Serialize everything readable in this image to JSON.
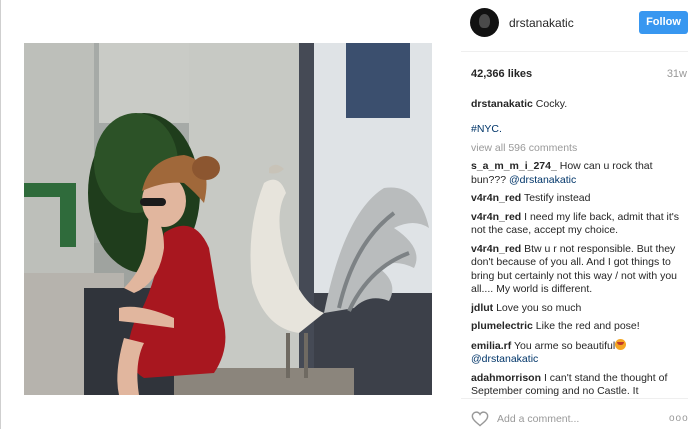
{
  "post": {
    "username": "drstanakatic",
    "follow_label": "Follow",
    "likes": "42,366 likes",
    "age": "31w",
    "caption_user": "drstanakatic",
    "caption_text": "Cocky.",
    "hashtag": "#NYC.",
    "view_all": "view all 596 comments",
    "add_comment_placeholder": "Add a comment...",
    "more": "ooo"
  },
  "comments": [
    {
      "user": "s_a_m_m_i_274_",
      "text": "How can u rock that bun???",
      "mention": "@drstanakatic"
    },
    {
      "user": "v4r4n_red",
      "text": "Testify instead"
    },
    {
      "user": "v4r4n_red",
      "text": "I need my life back, admit that it's not the case, accept my choice."
    },
    {
      "user": "v4r4n_red",
      "text": "Btw u r not responsible. But they don't because of you all. And I got things to bring but certainly not this way / not with you all.... My world is different."
    },
    {
      "user": "jdlut",
      "text": "Love you so much"
    },
    {
      "user": "plumelectric",
      "text": "Like the red and pose!"
    },
    {
      "user": "emilia.rf",
      "text": "You arme so beautiful",
      "mention": "@drstanakatic"
    },
    {
      "user": "adahmorrison",
      "text": "I can't stand the thought of September coming and no Castle. It"
    }
  ],
  "icons": {
    "heart": "heart-icon",
    "emoji": "heart-eyes-emoji-icon"
  },
  "colors": {
    "follow_button": "#3897f0",
    "link": "#003569",
    "muted": "#999999"
  }
}
